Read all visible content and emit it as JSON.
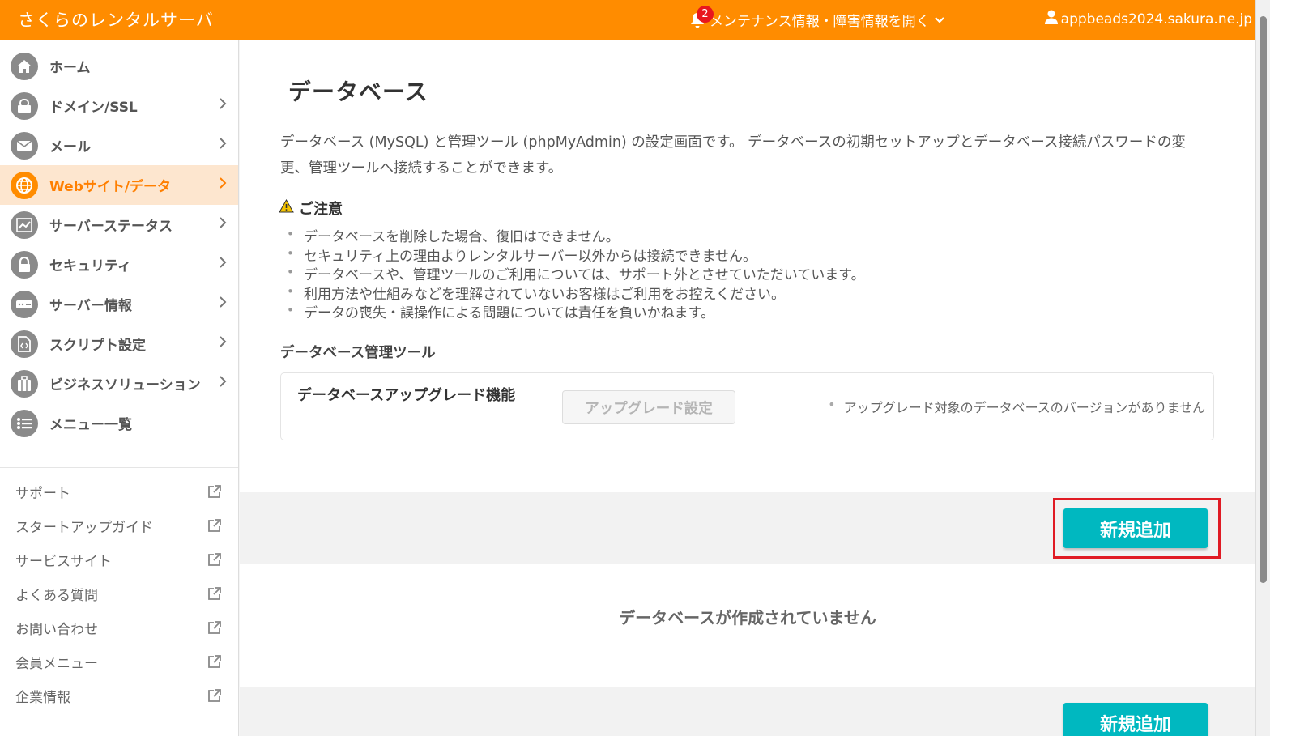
{
  "header": {
    "brand": "さくらのレンタルサーバ",
    "maintenance_label": "メンテナンス情報・障害情報を開く",
    "notification_count": "2",
    "user_account": "appbeads2024.sakura.ne.jp"
  },
  "sidebar": {
    "items": [
      {
        "label": "ホーム",
        "icon": "home-icon"
      },
      {
        "label": "ドメイン/SSL",
        "icon": "domain-icon"
      },
      {
        "label": "メール",
        "icon": "mail-icon"
      },
      {
        "label": "Webサイト/データ",
        "icon": "globe-icon"
      },
      {
        "label": "サーバーステータス",
        "icon": "chart-icon"
      },
      {
        "label": "セキュリティ",
        "icon": "lock-icon"
      },
      {
        "label": "サーバー情報",
        "icon": "server-icon"
      },
      {
        "label": "スクリプト設定",
        "icon": "script-icon"
      },
      {
        "label": "ビジネスソリューション",
        "icon": "briefcase-icon"
      },
      {
        "label": "メニュー一覧",
        "icon": "list-icon"
      }
    ],
    "links": [
      {
        "label": "サポート"
      },
      {
        "label": "スタートアップガイド"
      },
      {
        "label": "サービスサイト"
      },
      {
        "label": "よくある質問"
      },
      {
        "label": "お問い合わせ"
      },
      {
        "label": "会員メニュー"
      },
      {
        "label": "企業情報"
      }
    ]
  },
  "main": {
    "title": "データベース",
    "description": "データベース (MySQL) と管理ツール (phpMyAdmin) の設定画面です。 データベースの初期セットアップとデータベース接続パスワードの変更、管理ツールへ接続することができます。",
    "notice_title": "ご注意",
    "notes": [
      "データベースを削除した場合、復旧はできません。",
      "セキュリティ上の理由よりレンタルサーバー以外からは接続できません。",
      "データベースや、管理ツールのご利用については、サポート外とさせていただいています。",
      "利用方法や仕組みなどを理解されていないお客様はご利用をお控えください。",
      "データの喪失・誤操作による問題については責任を負いかねます。"
    ],
    "tool_section_title": "データベース管理ツール",
    "tool_name": "データベースアップグレード機能",
    "upgrade_button": "アップグレード設定",
    "upgrade_note": "アップグレード対象のデータベースのバージョンがありません",
    "new_button": "新規追加",
    "empty_message": "データベースが作成されていません"
  },
  "colors": {
    "header": "#ff8c00",
    "active_nav_bg": "#fde6cf",
    "accent_button": "#00b8c0",
    "highlight_box": "#e01b24"
  }
}
